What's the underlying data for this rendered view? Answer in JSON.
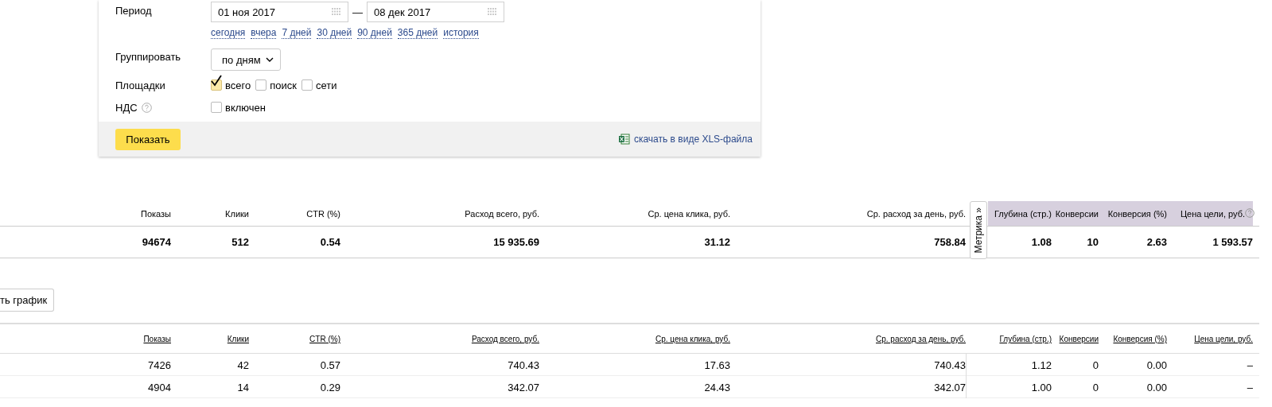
{
  "form": {
    "period": {
      "label": "Период",
      "from": "01 ноя 2017",
      "to": "08 дек 2017",
      "separator": "—",
      "quick_links": [
        "сегодня",
        "вчера",
        "7 дней",
        "30 дней",
        "90 дней",
        "365 дней",
        "история"
      ]
    },
    "grouping": {
      "label": "Группировать",
      "value": "по дням"
    },
    "platforms": {
      "label": "Площадки",
      "options": [
        {
          "label": "всего",
          "checked": true
        },
        {
          "label": "поиск",
          "checked": false
        },
        {
          "label": "сети",
          "checked": false
        }
      ]
    },
    "vat": {
      "label": "НДС",
      "options": [
        {
          "label": "включен",
          "checked": false
        }
      ]
    },
    "submit": "Показать",
    "download": "скачать в виде XLS-файла"
  },
  "summary": {
    "columns": [
      "Показы",
      "Клики",
      "CTR (%)",
      "Расход всего, руб.",
      "Ср. цена клика, руб.",
      "Ср. расход за день, руб."
    ],
    "metrika_tab": "Метрика »",
    "metrika_columns": [
      "Глубина (стр.)",
      "Конверсии",
      "Конверсия (%)",
      "Цена цели, руб."
    ],
    "values": [
      "94674",
      "512",
      "0.54",
      "15 935.69",
      "31.12",
      "758.84"
    ],
    "metrika_values": [
      "1.08",
      "10",
      "2.63",
      "1 593.57"
    ]
  },
  "chart_button": "ть график",
  "detail": {
    "columns": [
      "Показы",
      "Клики",
      "CTR (%)",
      "Расход всего, руб.",
      "Ср. цена клика, руб.",
      "Ср. расход за день, руб.",
      "Глубина (стр.)",
      "Конверсии",
      "Конверсия (%)",
      "Цена цели, руб."
    ],
    "rows": [
      [
        "7426",
        "42",
        "0.57",
        "740.43",
        "17.63",
        "740.43",
        "1.12",
        "0",
        "0.00",
        "–"
      ],
      [
        "4904",
        "14",
        "0.29",
        "342.07",
        "24.43",
        "342.07",
        "1.00",
        "0",
        "0.00",
        "–"
      ]
    ]
  }
}
